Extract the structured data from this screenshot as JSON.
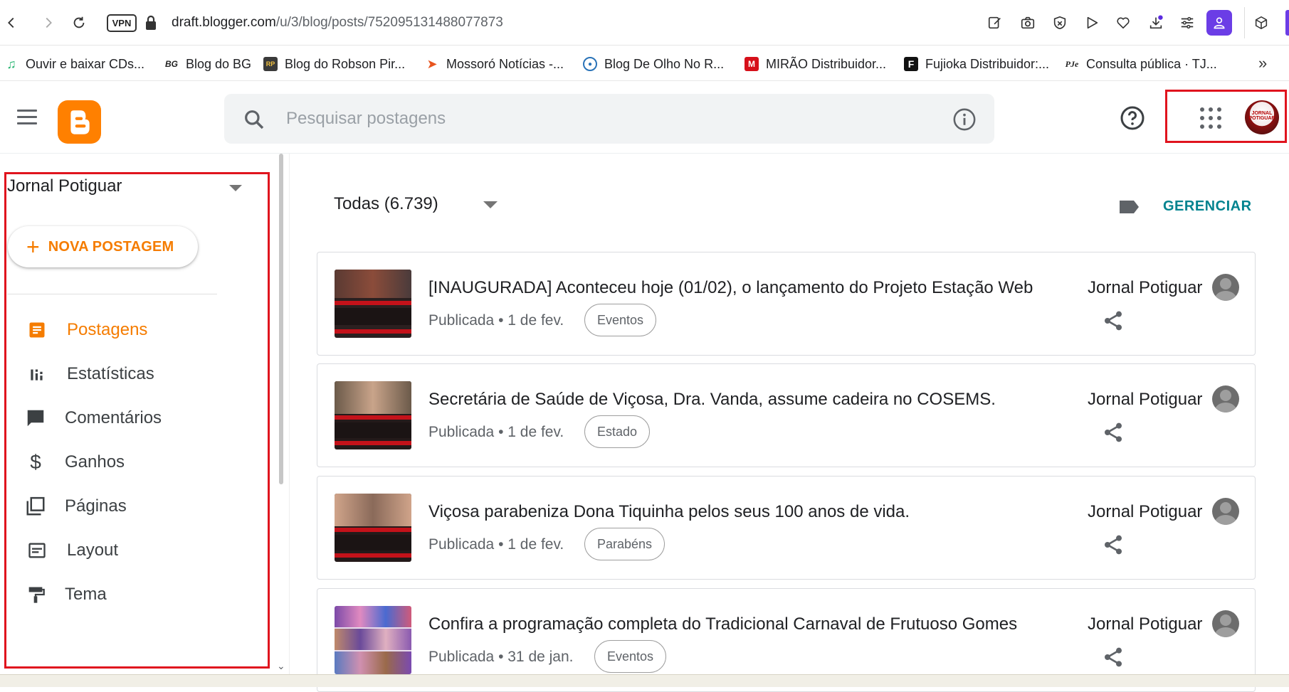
{
  "browser": {
    "vpn_label": "VPN",
    "url_domain": "draft.blogger.com",
    "url_path": "/u/3/blog/posts/752095131488077873"
  },
  "bookmarks": [
    {
      "label": "Ouvir e baixar CDs...",
      "icon": "music-note-icon",
      "color": "#2bb673"
    },
    {
      "label": "Blog do BG",
      "icon": "bg-logo-icon",
      "color": "#222222"
    },
    {
      "label": "Blog do Robson Pir...",
      "icon": "robson-logo-icon",
      "color": "#444444"
    },
    {
      "label": "Mossoró Notícias -...",
      "icon": "mossoro-logo-icon",
      "color": "#e8541e"
    },
    {
      "label": "Blog De Olho No R...",
      "icon": "eye-logo-icon",
      "color": "#2a73b8"
    },
    {
      "label": "MIRÃO Distribuidor...",
      "icon": "mirao-logo-icon",
      "color": "#d6101a"
    },
    {
      "label": "Fujioka Distribuidor:...",
      "icon": "fujioka-logo-icon",
      "color": "#111111"
    },
    {
      "label": "Consulta pública · TJ...",
      "icon": "pje-logo-icon",
      "color": "#222222"
    }
  ],
  "header": {
    "search_placeholder": "Pesquisar postagens"
  },
  "sidebar": {
    "blog_name": "Jornal Potiguar",
    "new_post_label": "NOVA POSTAGEM",
    "items": [
      {
        "label": "Postagens",
        "icon": "posts-icon",
        "active": true
      },
      {
        "label": "Estatísticas",
        "icon": "stats-icon",
        "active": false
      },
      {
        "label": "Comentários",
        "icon": "comments-icon",
        "active": false
      },
      {
        "label": "Ganhos",
        "icon": "dollar-icon",
        "active": false
      },
      {
        "label": "Páginas",
        "icon": "pages-icon",
        "active": false
      },
      {
        "label": "Layout",
        "icon": "layout-icon",
        "active": false
      },
      {
        "label": "Tema",
        "icon": "paint-roller-icon",
        "active": false
      }
    ]
  },
  "main": {
    "filter_label": "Todas (6.739)",
    "manage_label": "GERENCIAR",
    "posts": [
      {
        "title": "[INAUGURADA] Aconteceu hoje (01/02), o lançamento do Projeto Estação Web",
        "status": "Publicada • 1 de fev.",
        "label": "Eventos",
        "author": "Jornal Potiguar"
      },
      {
        "title": "Secretária de Saúde de Viçosa, Dra. Vanda, assume cadeira no COSEMS.",
        "status": "Publicada • 1 de fev.",
        "label": "Estado",
        "author": "Jornal Potiguar"
      },
      {
        "title": "Viçosa parabeniza Dona Tiquinha pelos seus 100 anos de vida.",
        "status": "Publicada • 1 de fev.",
        "label": "Parabéns",
        "author": "Jornal Potiguar"
      },
      {
        "title": "Confira a programação completa do Tradicional Carnaval de Frutuoso Gomes",
        "status": "Publicada • 31 de jan.",
        "label": "Eventos",
        "author": "Jornal Potiguar"
      }
    ]
  },
  "colors": {
    "accent_orange": "#f57c00",
    "blogger_logo": "#ff8000",
    "manage_teal": "#00838f",
    "highlight_red": "#e0141e",
    "profile_purple": "#6b3de6"
  }
}
